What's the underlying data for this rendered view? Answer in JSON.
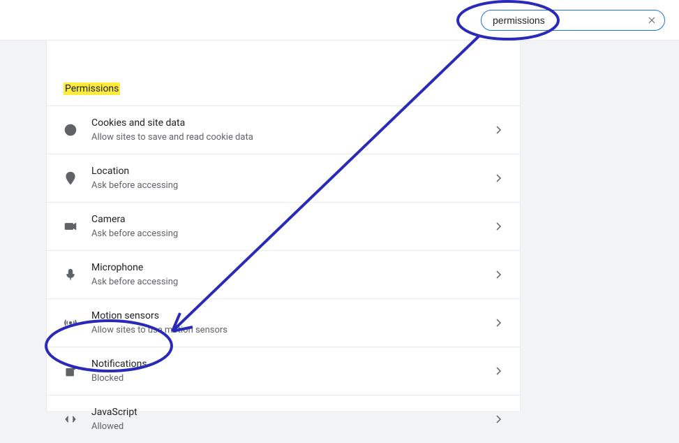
{
  "search": {
    "value": "permissions"
  },
  "section": {
    "title": "Permissions"
  },
  "rows": [
    {
      "title": "Cookies and site data",
      "sub": "Allow sites to save and read cookie data"
    },
    {
      "title": "Location",
      "sub": "Ask before accessing"
    },
    {
      "title": "Camera",
      "sub": "Ask before accessing"
    },
    {
      "title": "Microphone",
      "sub": "Ask before accessing"
    },
    {
      "title": "Motion sensors",
      "sub": "Allow sites to use motion sensors"
    },
    {
      "title": "Notifications",
      "sub": "Blocked"
    },
    {
      "title": "JavaScript",
      "sub": "Allowed"
    }
  ]
}
